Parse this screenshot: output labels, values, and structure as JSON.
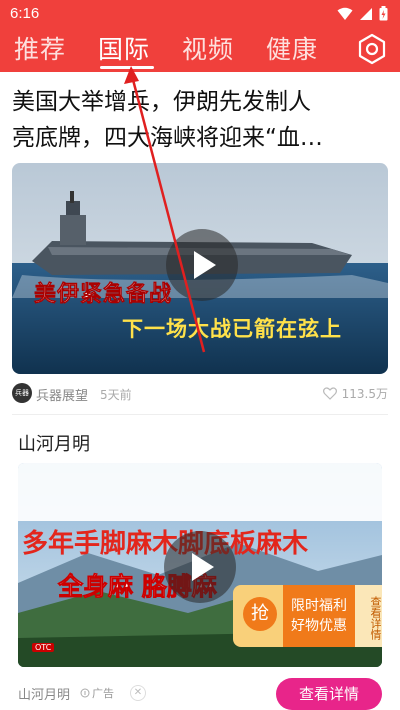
{
  "status_bar": {
    "time": "6:16"
  },
  "tabs": [
    {
      "label": "推荐",
      "active": false
    },
    {
      "label": "国际",
      "active": true
    },
    {
      "label": "视频",
      "active": false
    },
    {
      "label": "健康",
      "active": false
    }
  ],
  "colors": {
    "brand_red": "#f0403c",
    "cta_pink": "#e8258a"
  },
  "article": {
    "headline": "美国大举增兵，伊朗先发制人亮底牌，四大海峡将迎来“血…",
    "headline_line1": "美国大举增兵，伊朗先发制人",
    "headline_line2": "亮底牌，四大海峡将迎来“血…",
    "video_caption_1": "美伊紧急备战",
    "video_caption_2": "下一场大战已箭在弦上",
    "source_logo_text": "兵器",
    "source": "兵器展望",
    "time": "5天前",
    "likes": "113.5万"
  },
  "ad": {
    "title": "山河月明",
    "overlay_line1_a": "多年",
    "overlay_line1_b": "手脚麻木脚底板麻木",
    "overlay_line2": "全身麻 胳膊麻 ",
    "otc": "OTC",
    "promo_icon": "抢",
    "promo_line1": "限时福利",
    "promo_line2": "好物优惠",
    "promo_side": "查看详情",
    "advertiser": "山河月明",
    "ad_label": "广告",
    "cta": "查看详情"
  }
}
